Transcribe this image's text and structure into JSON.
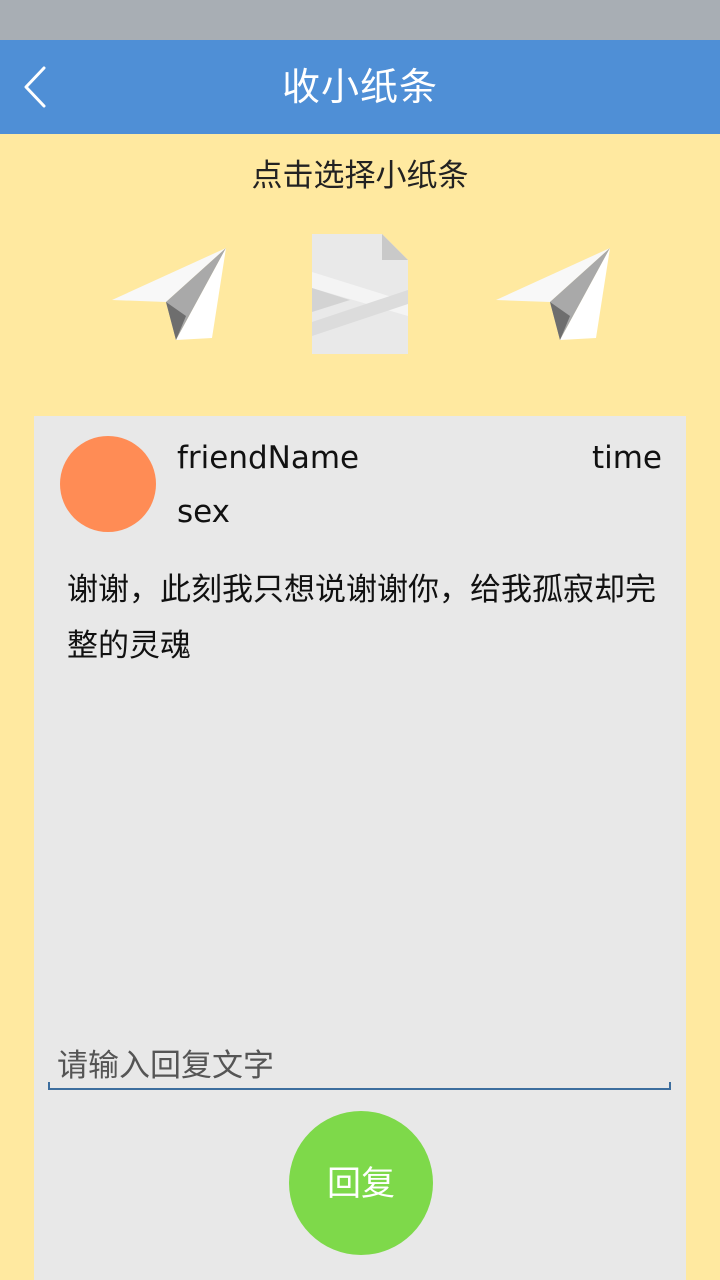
{
  "app_bar": {
    "title": "收小纸条",
    "color": "#4F8FD6"
  },
  "hint": "点击选择小纸条",
  "icons": {
    "back": "chevron-left-icon",
    "left_plane": "paper-plane-icon",
    "center_note": "folded-paper-icon",
    "right_plane": "paper-plane-icon"
  },
  "note": {
    "friend_name": "friendName",
    "time": "time",
    "sex": "sex",
    "message": "谢谢，此刻我只想说谢谢你，给我孤寂却完整的灵魂",
    "avatar_color": "#FF8C55"
  },
  "reply": {
    "placeholder": "请输入回复文字",
    "value": "",
    "button_label": "回复",
    "button_color": "#7ED94A"
  },
  "colors": {
    "background": "#FFE9A0",
    "card": "#E8E8E8"
  }
}
